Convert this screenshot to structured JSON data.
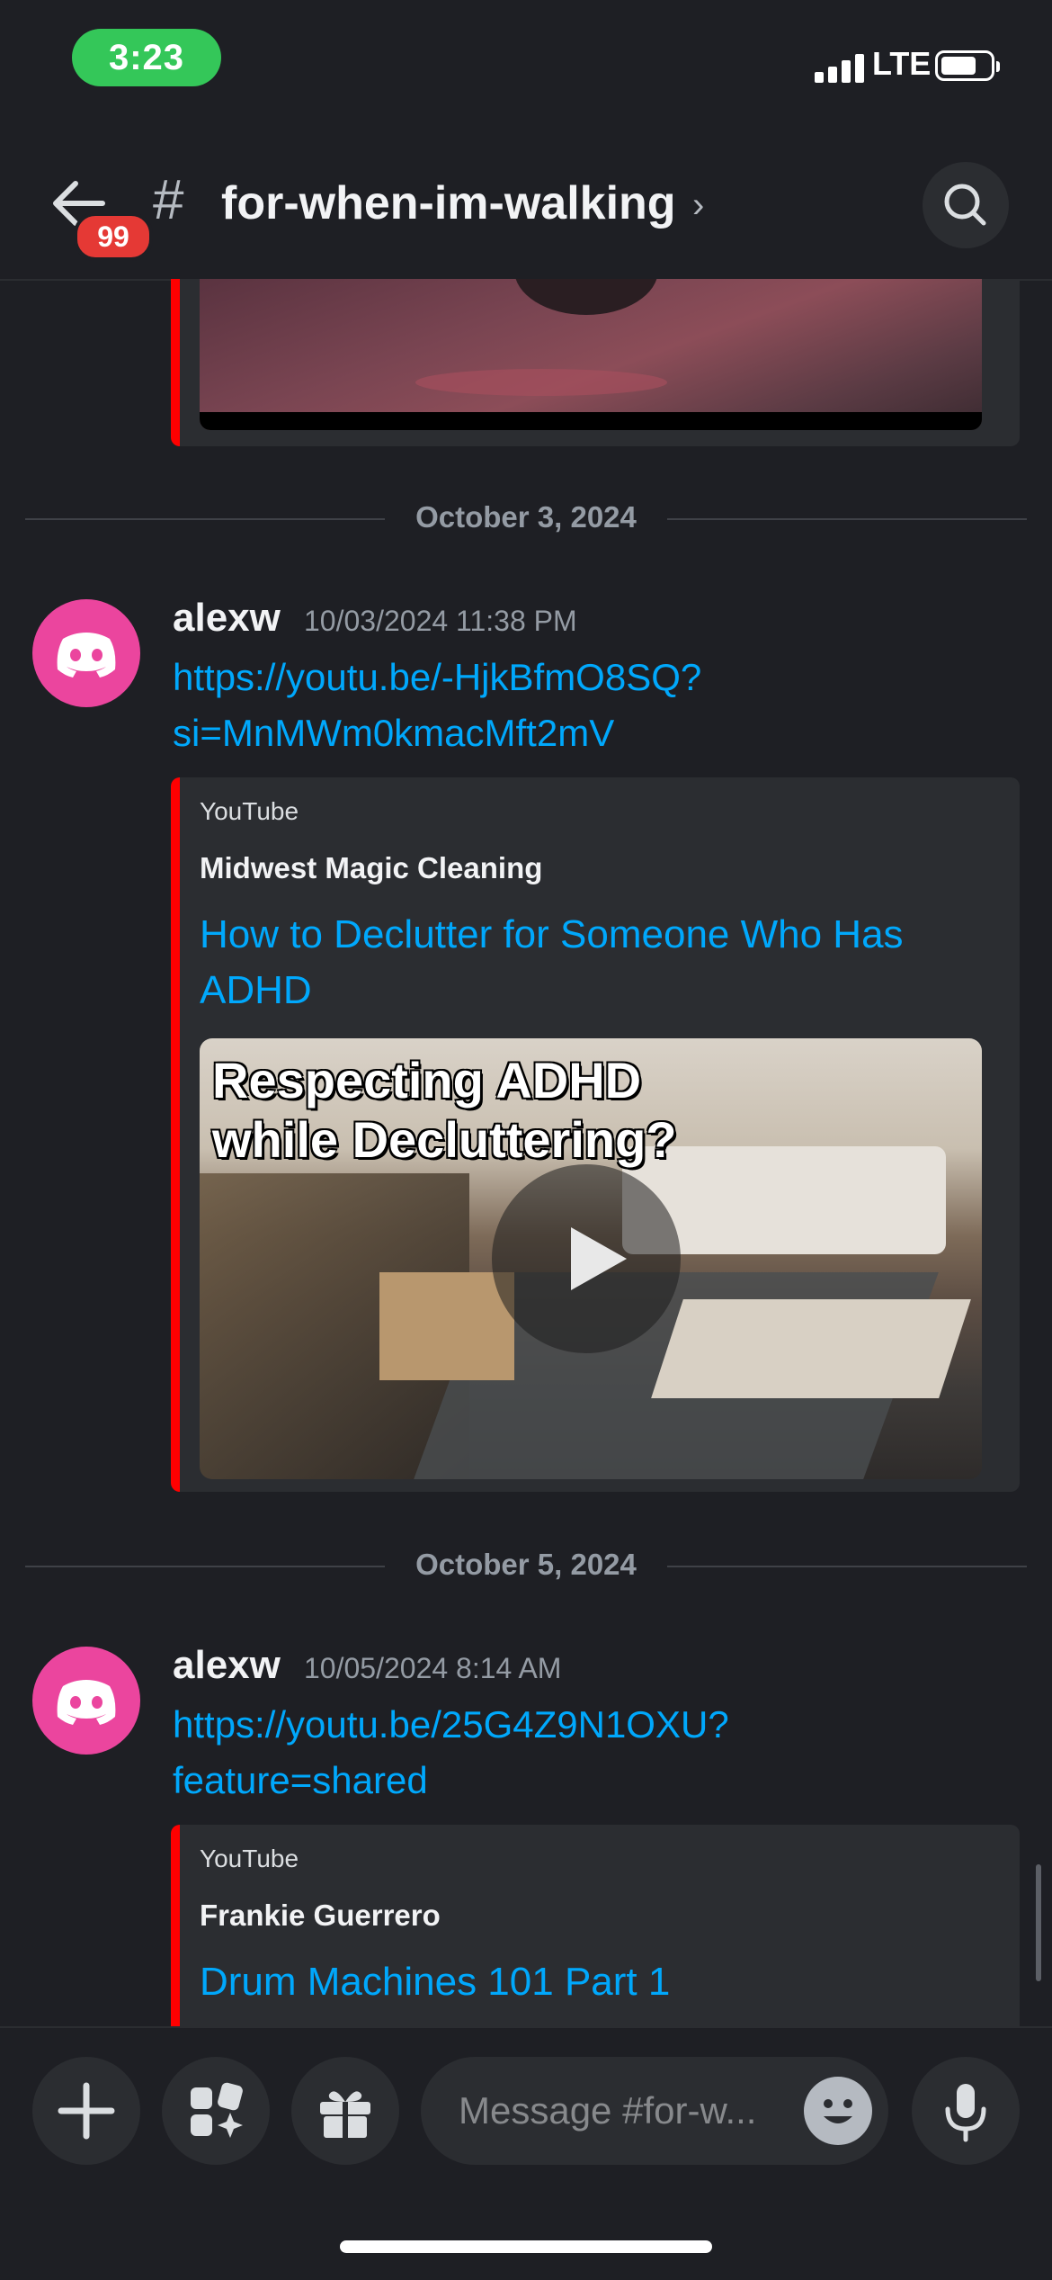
{
  "status_bar": {
    "time": "3:23",
    "network": "LTE"
  },
  "header": {
    "notification_count": "99",
    "channel_name": "for-when-im-walking",
    "chevron": "›"
  },
  "messages_top": {
    "embed_thumbnail_icon": "video-thumbnail"
  },
  "dividers": [
    {
      "date": "October 3, 2024"
    },
    {
      "date": "October 5, 2024"
    }
  ],
  "messages": [
    {
      "author": "alexw",
      "timestamp": "10/03/2024 11:38 PM",
      "link_line1": "https://youtu.be/-HjkBfmO8SQ?",
      "link_line2": "si=MnMWm0kmacMft2mV",
      "embed": {
        "provider": "YouTube",
        "author": "Midwest Magic Cleaning",
        "title_line1": "How to Declutter for Someone Who Has",
        "title_line2": "ADHD",
        "thumbnail_caption_line1": "Respecting ADHD",
        "thumbnail_caption_line2": "while Decluttering?"
      }
    },
    {
      "author": "alexw",
      "timestamp": "10/05/2024 8:14 AM",
      "link_line1": "https://youtu.be/25G4Z9N1OXU?",
      "link_line2": "feature=shared",
      "embed": {
        "provider": "YouTube",
        "author": "Frankie Guerrero",
        "title_line1": "Drum Machines 101 Part 1"
      }
    }
  ],
  "composer": {
    "placeholder": "Message #for-w..."
  },
  "colors": {
    "background": "#1e1f24",
    "link": "#00a8fc",
    "avatar": "#eb459e",
    "youtube_accent": "#ff0000",
    "badge": "#e53935",
    "time_pill": "#34c759"
  }
}
